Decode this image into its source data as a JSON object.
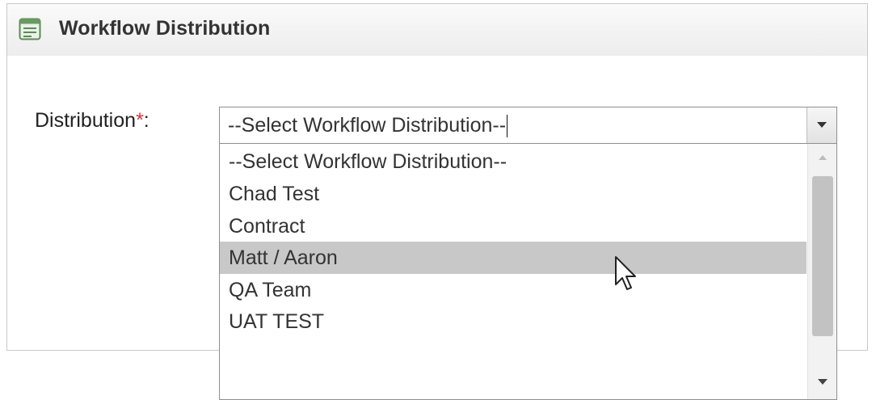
{
  "panel": {
    "title": "Workflow Distribution",
    "icon": "form-list-icon"
  },
  "form": {
    "distribution_label": "Distribution",
    "required_marker": "*",
    "label_suffix": ":"
  },
  "select": {
    "value": "--Select Workflow Distribution--",
    "expanded": true,
    "options": [
      "--Select Workflow Distribution--",
      "Chad Test",
      "Contract",
      "Matt / Aaron",
      "QA Team",
      "UAT TEST"
    ],
    "highlighted": "Matt / Aaron"
  },
  "icons": {
    "dropdown_arrow": "chevron-down-icon",
    "scroll_up": "scroll-up-icon",
    "scroll_down": "scroll-down-icon",
    "pointer": "mouse-pointer-icon"
  },
  "colors": {
    "highlight": "#c8c8c8",
    "required": "#e0303a",
    "header_bg": "#ededed"
  }
}
